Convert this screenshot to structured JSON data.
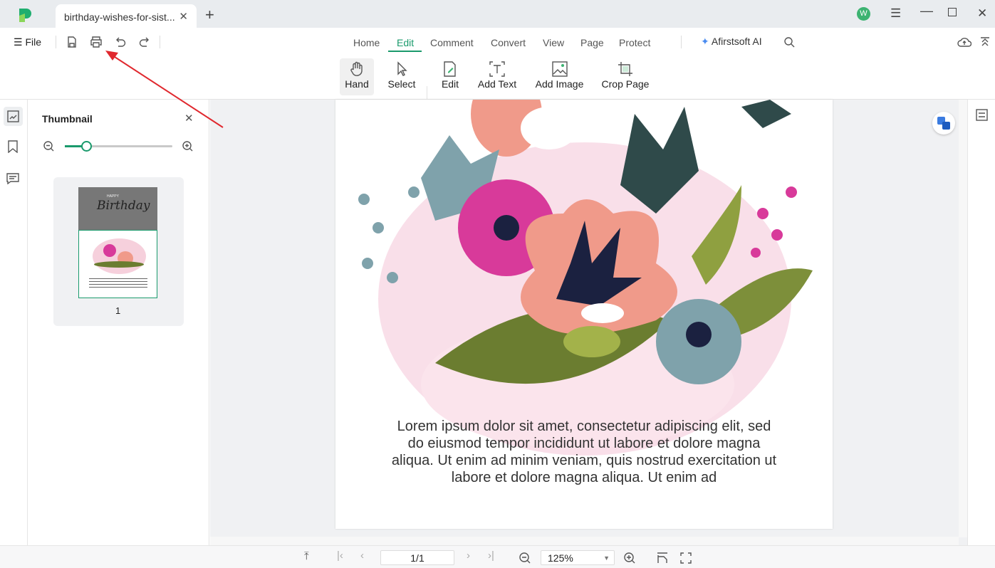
{
  "tabbar": {
    "doc_tab": "birthday-wishes-for-sist...",
    "avatar_letter": "W"
  },
  "toolbar": {
    "file_label": "File",
    "menus": [
      "Home",
      "Edit",
      "Comment",
      "Convert",
      "View",
      "Page",
      "Protect"
    ],
    "active_menu": "Edit",
    "ai_label": "Afirstsoft AI",
    "tools": [
      "Hand",
      "Select",
      "Edit",
      "Add Text",
      "Add Image",
      "Crop Page"
    ]
  },
  "thumbnail": {
    "title": "Thumbnail",
    "zoom_fraction": 0.2,
    "page_number": "1",
    "thumb_title": "Birthday",
    "thumb_happy": "HAPPY"
  },
  "page": {
    "text": "Lorem ipsum dolor sit amet, consectetur adipiscing elit, sed do eiusmod tempor incididunt ut labore et dolore magna aliqua. Ut enim ad minim veniam, quis nostrud exercitation ut labore et dolore magna aliqua. Ut enim ad",
    "lines": [
      "Lorem ipsum dolor sit amet, consectetur adipiscing elit, sed",
      "do eiusmod tempor incididunt ut labore et dolore magna",
      "aliqua. Ut enim ad minim veniam, quis nostrud exercitation ut",
      "labore et dolore magna aliqua. Ut enim ad"
    ]
  },
  "bottombar": {
    "page_value": "1/1",
    "zoom_value": "125%"
  },
  "colors": {
    "accent": "#1a9a6c",
    "annotation_arrow": "#e0282e"
  }
}
